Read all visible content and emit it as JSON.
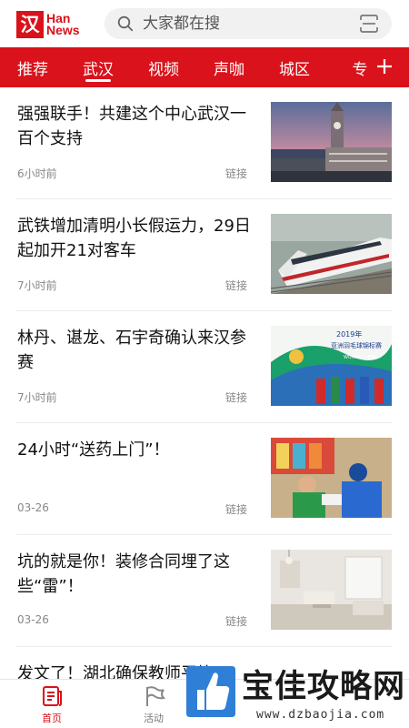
{
  "header": {
    "logo_mark": "汉",
    "logo_line1": "Han",
    "logo_line2": "News",
    "search_placeholder": "大家都在搜",
    "icons": [
      "search-icon",
      "scan-icon"
    ]
  },
  "tabs": [
    "推荐",
    "武汉",
    "视频",
    "声咖",
    "城区",
    "专"
  ],
  "active_tab": "武汉",
  "colors": {
    "brand": "#d9121b",
    "text": "#111111",
    "meta": "#888888"
  },
  "feed": [
    {
      "title": "强强联手！共建这个中心武汉一百个支持",
      "time": "6小时前",
      "source": "链接",
      "image": "clock-tower-skyline"
    },
    {
      "title": "武铁增加清明小长假运力，29日起加开21对客车",
      "time": "7小时前",
      "source": "链接",
      "image": "high-speed-train"
    },
    {
      "title": "林丹、谌龙、石宇奇确认来汉参赛",
      "time": "7小时前",
      "source": "链接",
      "image": "badminton-poster",
      "image_text": {
        "year": "2019年",
        "event": "亚洲羽毛球锦标赛",
        "city": "WUHAN CHINA"
      }
    },
    {
      "title": "24小时“送药上门”！",
      "time": "03-26",
      "source": "链接",
      "image": "medicine-delivery"
    },
    {
      "title": "坑的就是你！装修合同埋了这些“雷”！",
      "time": "03-26",
      "source": "链接",
      "image": "living-room"
    },
    {
      "title": "发文了！湖北确保教师平均",
      "time": "",
      "source": "",
      "image": ""
    }
  ],
  "bottom_nav": [
    {
      "label": "首页",
      "icon": "home-news-icon",
      "active": true
    },
    {
      "label": "活动",
      "icon": "flag-icon",
      "active": false
    }
  ],
  "watermark": {
    "text": "宝佳攻略网",
    "url": "www.dzbaojia.com"
  }
}
